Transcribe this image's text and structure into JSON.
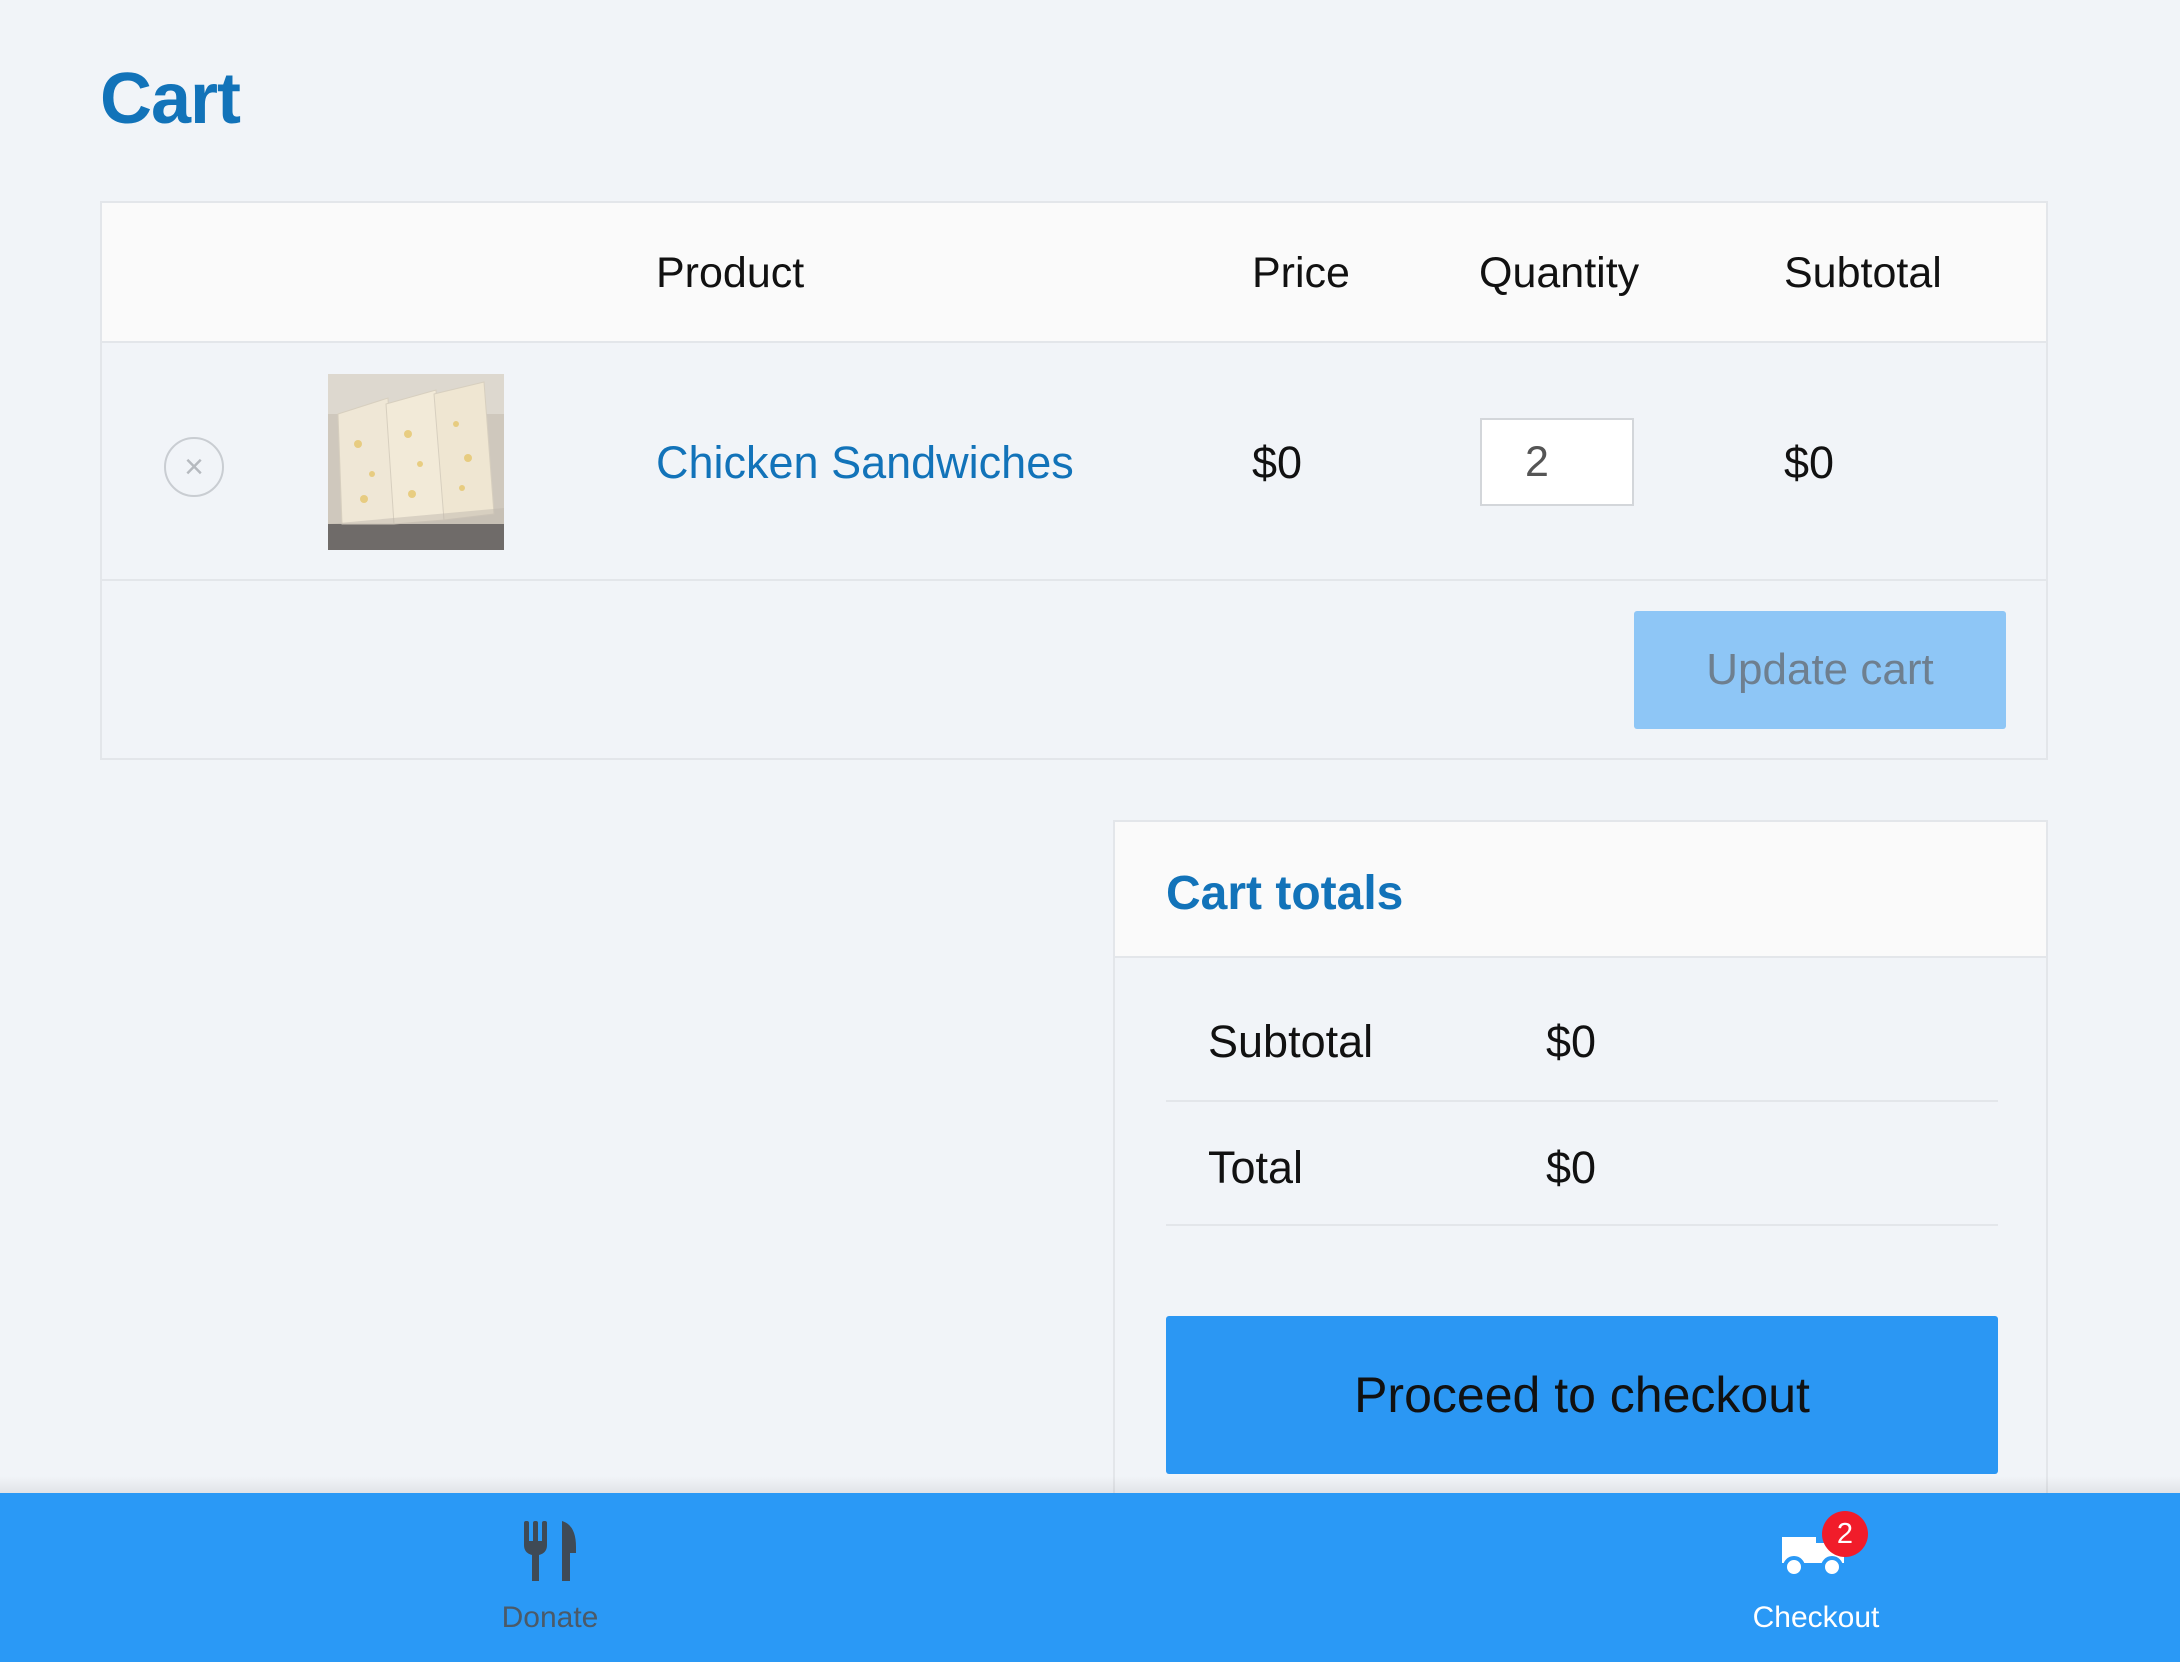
{
  "page": {
    "title": "Cart"
  },
  "cart_table": {
    "headers": {
      "product": "Product",
      "price": "Price",
      "quantity": "Quantity",
      "subtotal": "Subtotal"
    },
    "items": [
      {
        "remove_icon": "close-icon",
        "name": "Chicken Sandwiches",
        "price": "$0",
        "quantity": "2",
        "subtotal": "$0"
      }
    ],
    "update_label": "Update cart"
  },
  "cart_totals": {
    "title": "Cart totals",
    "subtotal_label": "Subtotal",
    "subtotal_value": "$0",
    "total_label": "Total",
    "total_value": "$0",
    "checkout_label": "Proceed to checkout"
  },
  "bottom_nav": {
    "items": [
      {
        "label": "Donate",
        "icon": "utensils-icon"
      },
      {
        "label": "Checkout",
        "icon": "truck-icon",
        "badge": "2"
      }
    ]
  },
  "colors": {
    "accent": "#1273b9",
    "nav_bar": "#2a99f6",
    "checkout_button": "#2b97f3",
    "update_button": "#8ec6f6",
    "badge": "#f11c2a",
    "background": "#f1f4f8"
  }
}
